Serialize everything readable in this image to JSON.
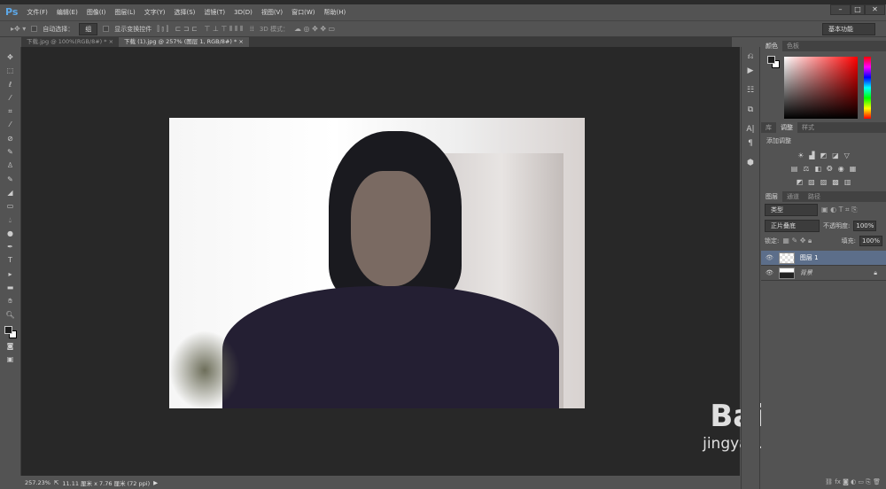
{
  "app": {
    "logo": "Ps",
    "menu": [
      "文件(F)",
      "编辑(E)",
      "图像(I)",
      "图层(L)",
      "文字(Y)",
      "选择(S)",
      "滤镜(T)",
      "3D(D)",
      "视图(V)",
      "窗口(W)",
      "帮助(H)"
    ],
    "window_buttons": [
      "–",
      "□",
      "✕"
    ]
  },
  "options": {
    "auto_select_label": "自动选择：",
    "auto_select_value": "组",
    "show_transform_label": "显示变换控件",
    "mode_3d_label": "3D 模式：",
    "workspace": "基本功能"
  },
  "tabs": [
    {
      "label": "下载.jpg @ 100%(RGB/8#) *",
      "close": "×"
    },
    {
      "label": "下载 (1).jpg @ 257% (图层 1, RGB/8#) *",
      "close": "×"
    }
  ],
  "tools": [
    "move",
    "marquee",
    "lasso",
    "quick-select",
    "crop",
    "eyedropper",
    "healing",
    "brush",
    "stamp",
    "history-brush",
    "eraser",
    "gradient",
    "blur",
    "dodge",
    "pen",
    "type",
    "path-select",
    "rectangle",
    "hand",
    "zoom"
  ],
  "status": {
    "zoom": "257.23%",
    "doc_size": "11.11 厘米 x 7.76 厘米 (72 ppi)"
  },
  "panels": {
    "color": {
      "tabs": [
        "颜色",
        "色板"
      ],
      "foreground": "#1e1e1e",
      "background": "#ffffff",
      "hue": "#ff0000"
    },
    "adjustments": {
      "tabs": [
        "库",
        "调整",
        "样式"
      ],
      "title": "添加调整"
    },
    "layers": {
      "tabs": [
        "图层",
        "通道",
        "路径"
      ],
      "filter": "类型",
      "blend_mode": "正片叠底",
      "opacity_label": "不透明度:",
      "opacity": "100%",
      "lock_label": "锁定:",
      "fill_label": "填充:",
      "fill": "100%",
      "items": [
        {
          "name": "图层 1",
          "selected": true
        },
        {
          "name": "背景",
          "locked": true
        }
      ]
    }
  },
  "watermark": {
    "brand": "Bai 经验",
    "url": "jingyan.baidu.com"
  }
}
